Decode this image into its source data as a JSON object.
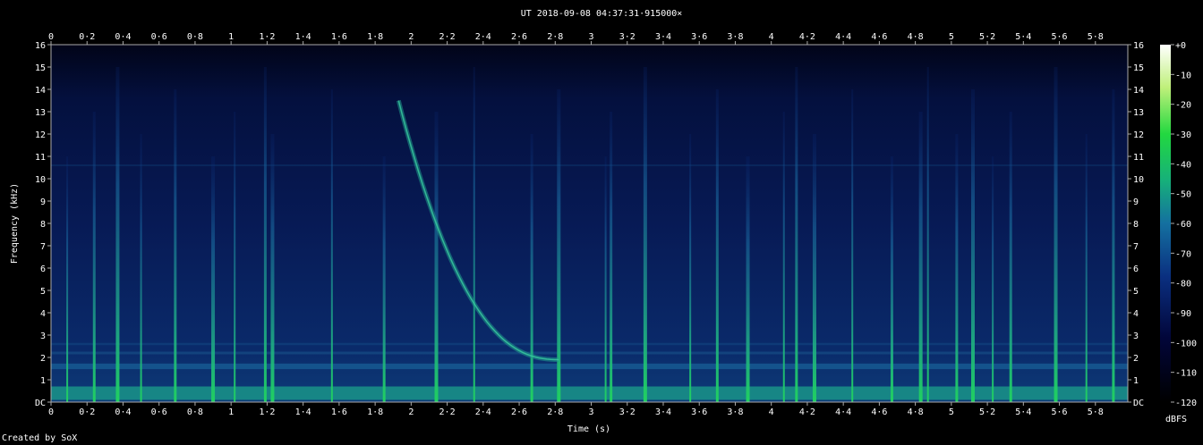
{
  "chart_data": {
    "type": "heatmap",
    "title": "UT 2018-09-08 04:37:31·915000×",
    "xlabel": "Time (s)",
    "ylabel": "Frequency (kHz)",
    "xlim": [
      0,
      5.98
    ],
    "ylim": [
      0,
      16
    ],
    "x_ticks": [
      "0",
      "0·2",
      "0·4",
      "0·6",
      "0·8",
      "1",
      "1·2",
      "1·4",
      "1·6",
      "1·8",
      "2",
      "2·2",
      "2·4",
      "2·6",
      "2·8",
      "3",
      "3·2",
      "3·4",
      "3·6",
      "3·8",
      "4",
      "4·2",
      "4·4",
      "4·6",
      "4·8",
      "5",
      "5·2",
      "5·4",
      "5·6",
      "5·8"
    ],
    "y_ticks": [
      "DC",
      "1",
      "2",
      "3",
      "4",
      "5",
      "6",
      "7",
      "8",
      "9",
      "10",
      "11",
      "12",
      "13",
      "14",
      "15",
      "16"
    ],
    "colorbar": {
      "label": "dBFS",
      "ticks": [
        "+0",
        "-10",
        "-20",
        "-30",
        "-40",
        "-50",
        "-60",
        "-70",
        "-80",
        "-90",
        "-100",
        "-110",
        "-120"
      ],
      "range": [
        -120,
        0
      ]
    },
    "vertical_lines_s": [
      0.09,
      0.24,
      0.37,
      0.5,
      0.69,
      0.9,
      1.02,
      1.19,
      1.23,
      1.56,
      1.85,
      2.14,
      2.35,
      2.67,
      2.82,
      3.08,
      3.11,
      3.3,
      3.55,
      3.7,
      3.87,
      4.07,
      4.14,
      4.24,
      4.45,
      4.67,
      4.83,
      4.87,
      5.03,
      5.12,
      5.23,
      5.33,
      5.58,
      5.75,
      5.9
    ],
    "sweep": {
      "description": "descending whistler",
      "start": {
        "time_s": 1.93,
        "freq_khz": 13.5
      },
      "end": {
        "time_s": 2.82,
        "freq_khz": 1.9
      }
    },
    "grid": false
  },
  "footer": "Created by SoX"
}
